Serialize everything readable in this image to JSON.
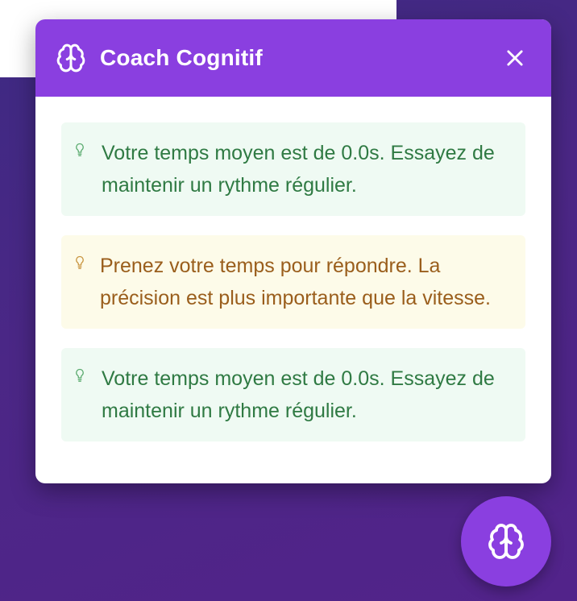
{
  "coach_panel": {
    "title": "Coach Cognitif",
    "header_icon": "brain-icon",
    "close_icon": "close-icon",
    "tips": [
      {
        "variant": "success",
        "icon": "lightbulb-icon",
        "text": "Votre temps moyen est de 0.0s. Essayez de maintenir un rythme régulier."
      },
      {
        "variant": "warning",
        "icon": "lightbulb-icon",
        "text": "Prenez votre temps pour répondre. La précision est plus importante que la vitesse."
      },
      {
        "variant": "success",
        "icon": "lightbulb-icon",
        "text": "Votre temps moyen est de 0.0s. Essayez de maintenir un rythme régulier."
      }
    ]
  },
  "fab": {
    "icon": "brain-icon"
  },
  "colors": {
    "accent": "#8a3fe0",
    "success_bg": "#effaf3",
    "success_text": "#2f7a43",
    "warning_bg": "#fdfbe9",
    "warning_text": "#9a5e1c",
    "background_gradient_start": "#3d2a82",
    "background_gradient_end": "#52238a"
  }
}
